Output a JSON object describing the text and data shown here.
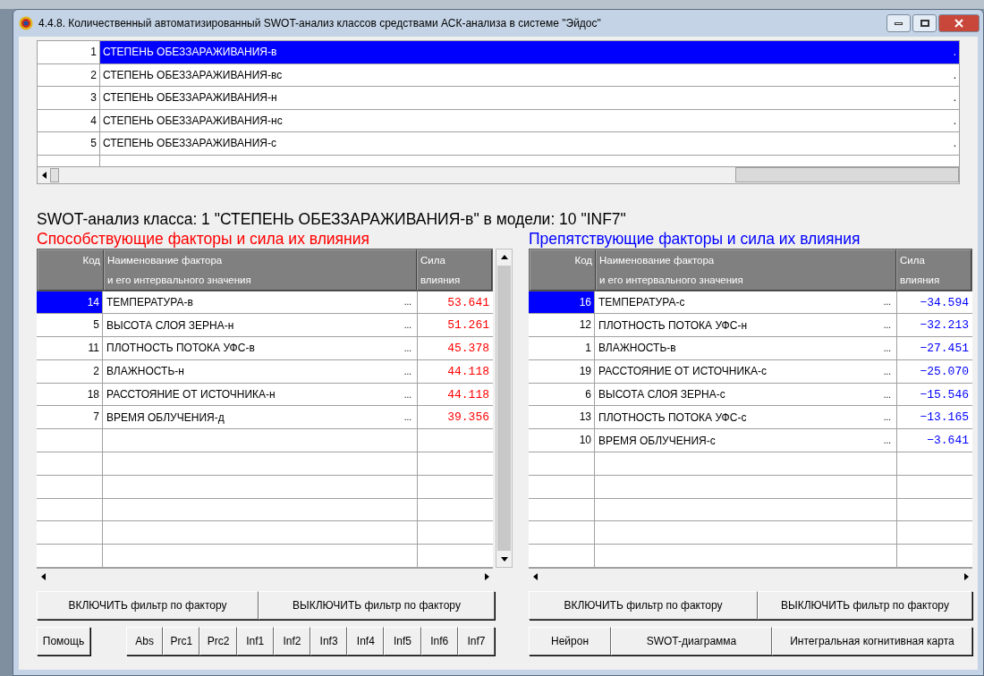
{
  "window": {
    "title": "4.4.8. Количественный автоматизированный SWOT-анализ классов средствами АСК-анализа в системе \"Эйдос\""
  },
  "class_list": [
    {
      "number": "1",
      "name": "СТЕПЕНЬ ОБЕЗЗАРАЖИВАНИЯ-в",
      "tail": ".",
      "selected": true
    },
    {
      "number": "2",
      "name": "СТЕПЕНЬ ОБЕЗЗАРАЖИВАНИЯ-вс",
      "tail": ".",
      "selected": false
    },
    {
      "number": "3",
      "name": "СТЕПЕНЬ ОБЕЗЗАРАЖИВАНИЯ-н",
      "tail": ".",
      "selected": false
    },
    {
      "number": "4",
      "name": "СТЕПЕНЬ ОБЕЗЗАРАЖИВАНИЯ-нс",
      "tail": ".",
      "selected": false
    },
    {
      "number": "5",
      "name": "СТЕПЕНЬ ОБЕЗЗАРАЖИВАНИЯ-с",
      "tail": ".",
      "selected": false
    }
  ],
  "analysis_title": "SWOT-анализ класса: 1 \"СТЕПЕНЬ ОБЕЗЗАРАЖИВАНИЯ-в\" в модели: 10 \"INF7\"",
  "panels": [
    {
      "title": "Способствующие факторы и сила их влияния",
      "color": "#ff0000",
      "vertical_scrollbar": true,
      "columns": [
        "Код",
        "Наименование фактора\nи его интервального значения",
        "Сила\nвлияния"
      ],
      "rows": [
        {
          "code": "14",
          "name": "ТЕМПЕРАТУРА-в",
          "more": "...",
          "value": "53.641",
          "selected": true
        },
        {
          "code": "5",
          "name": "ВЫСОТА СЛОЯ ЗЕРНА-н",
          "more": "...",
          "value": "51.261",
          "selected": false
        },
        {
          "code": "11",
          "name": "ПЛОТНОСТЬ ПОТОКА УФС-в",
          "more": "...",
          "value": "45.378",
          "selected": false
        },
        {
          "code": "2",
          "name": "ВЛАЖНОСТЬ-н",
          "more": "...",
          "value": "44.118",
          "selected": false
        },
        {
          "code": "18",
          "name": "РАССТОЯНИЕ ОТ ИСТОЧНИКА-н",
          "more": "...",
          "value": "44.118",
          "selected": false
        },
        {
          "code": "7",
          "name": "ВРЕМЯ ОБЛУЧЕНИЯ-д",
          "more": "...",
          "value": "39.356",
          "selected": false
        }
      ],
      "filter_buttons": [
        "ВКЛЮЧИТЬ фильтр по фактору",
        "ВЫКЛЮЧИТЬ фильтр по фактору"
      ]
    },
    {
      "title": "Препятствующие факторы и сила их влияния",
      "color": "#0000ff",
      "vertical_scrollbar": false,
      "columns": [
        "Код",
        "Наименование фактора\nи его интервального значения",
        "Сила\nвлияния"
      ],
      "rows": [
        {
          "code": "16",
          "name": "ТЕМПЕРАТУРА-с",
          "more": "...",
          "value": "−34.594",
          "selected": true
        },
        {
          "code": "12",
          "name": "ПЛОТНОСТЬ ПОТОКА УФС-н",
          "more": "...",
          "value": "−32.213",
          "selected": false
        },
        {
          "code": "1",
          "name": "ВЛАЖНОСТЬ-в",
          "more": "...",
          "value": "−27.451",
          "selected": false
        },
        {
          "code": "19",
          "name": "РАССТОЯНИЕ ОТ ИСТОЧНИКА-с",
          "more": "...",
          "value": "−25.070",
          "selected": false
        },
        {
          "code": "6",
          "name": "ВЫСОТА СЛОЯ ЗЕРНА-с",
          "more": "...",
          "value": "−15.546",
          "selected": false
        },
        {
          "code": "13",
          "name": "ПЛОТНОСТЬ ПОТОКА УФС-с",
          "more": "...",
          "value": "−13.165",
          "selected": false
        },
        {
          "code": "10",
          "name": "ВРЕМЯ ОБЛУЧЕНИЯ-с",
          "more": "...",
          "value": "−3.641",
          "selected": false
        }
      ],
      "filter_buttons": [
        "ВКЛЮЧИТЬ фильтр по фактору",
        "ВЫКЛЮЧИТЬ фильтр по фактору"
      ]
    }
  ],
  "help_button": "Помощь",
  "model_buttons": [
    "Abs",
    "Prc1",
    "Prc2",
    "Inf1",
    "Inf2",
    "Inf3",
    "Inf4",
    "Inf5",
    "Inf6",
    "Inf7"
  ],
  "output_buttons": [
    "Нейрон",
    "SWOT-диаграмма",
    "Интегральная когнитивная карта"
  ]
}
